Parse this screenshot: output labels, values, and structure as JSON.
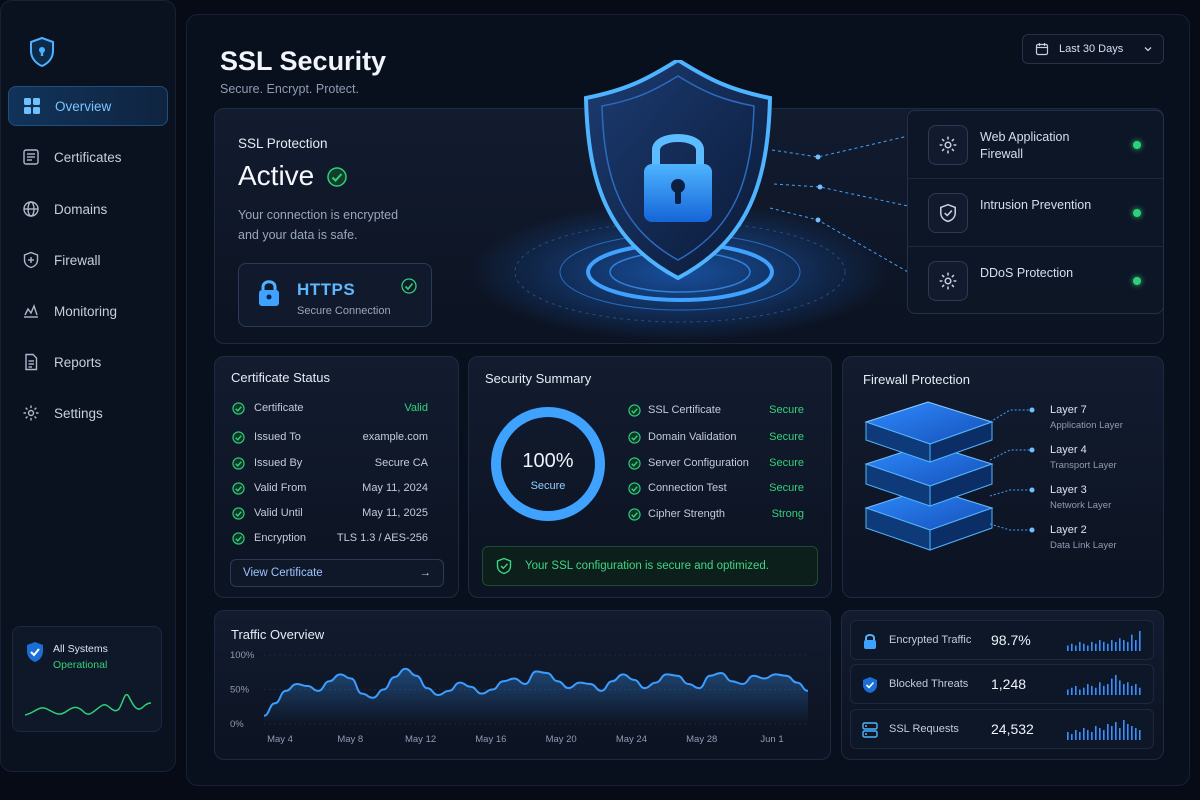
{
  "sidebar": {
    "items": [
      {
        "label": "Overview",
        "icon": "grid-icon",
        "active": true
      },
      {
        "label": "Certificates",
        "icon": "certificate-icon"
      },
      {
        "label": "Domains",
        "icon": "globe-icon"
      },
      {
        "label": "Firewall",
        "icon": "shield-plus-icon"
      },
      {
        "label": "Monitoring",
        "icon": "activity-icon"
      },
      {
        "label": "Reports",
        "icon": "document-icon"
      },
      {
        "label": "Settings",
        "icon": "gear-icon"
      }
    ],
    "status": {
      "title": "All Systems",
      "state": "Operational"
    }
  },
  "header": {
    "title": "SSL Security",
    "subtitle": "Secure. Encrypt. Protect.",
    "date_range": "Last 30 Days"
  },
  "hero": {
    "label": "SSL Protection",
    "status": "Active",
    "description": "Your connection is encrypted and your data is safe.",
    "https": {
      "title": "HTTPS",
      "subtitle": "Secure Connection"
    },
    "protections": [
      {
        "label": "Web Application Firewall",
        "status": "active"
      },
      {
        "label": "Intrusion Prevention",
        "status": "active"
      },
      {
        "label": "DDoS Protection",
        "status": "active"
      }
    ]
  },
  "certificate": {
    "title": "Certificate Status",
    "rows": [
      {
        "key": "Certificate",
        "value": "Valid"
      },
      {
        "key": "Issued To",
        "value": "example.com"
      },
      {
        "key": "Issued By",
        "value": "Secure CA"
      },
      {
        "key": "Valid From",
        "value": "May 11, 2024"
      },
      {
        "key": "Valid Until",
        "value": "May 11, 2025"
      },
      {
        "key": "Encryption",
        "value": "TLS 1.3 / AES-256"
      }
    ],
    "button": "View Certificate"
  },
  "summary": {
    "title": "Security Summary",
    "score": "100%",
    "score_label": "Secure",
    "score_fraction": 1.0,
    "rows": [
      {
        "key": "SSL Certificate",
        "value": "Secure"
      },
      {
        "key": "Domain Validation",
        "value": "Secure"
      },
      {
        "key": "Server Configuration",
        "value": "Secure"
      },
      {
        "key": "Connection Test",
        "value": "Secure"
      },
      {
        "key": "Cipher Strength",
        "value": "Strong"
      }
    ],
    "banner": "Your SSL configuration is secure and optimized."
  },
  "firewall": {
    "title": "Firewall Protection",
    "layers": [
      {
        "name": "Layer 7",
        "desc": "Application Layer"
      },
      {
        "name": "Layer 4",
        "desc": "Transport Layer"
      },
      {
        "name": "Layer 3",
        "desc": "Network Layer"
      },
      {
        "name": "Layer 2",
        "desc": "Data Link Layer"
      }
    ]
  },
  "traffic": {
    "title": "Traffic Overview"
  },
  "chart_data": {
    "type": "area",
    "title": "Traffic Overview",
    "xlabel": "",
    "ylabel": "",
    "y_ticks": [
      "100%",
      "50%",
      "0%"
    ],
    "ylim": [
      0,
      100
    ],
    "x_ticks": [
      "May 4",
      "May 8",
      "May 12",
      "May 16",
      "May 20",
      "May 24",
      "May 28",
      "Jun 1"
    ],
    "x": [
      0,
      1,
      2,
      3,
      4,
      5,
      6,
      7,
      8,
      9,
      10,
      11,
      12,
      13,
      14,
      15,
      16,
      17,
      18,
      19,
      20,
      21,
      22,
      23,
      24,
      25,
      26,
      27,
      28,
      29,
      30,
      31
    ],
    "values": [
      12,
      30,
      48,
      58,
      55,
      48,
      62,
      72,
      66,
      44,
      38,
      50,
      68,
      80,
      70,
      52,
      42,
      48,
      60,
      54,
      44,
      50,
      62,
      66,
      58,
      76,
      74,
      62,
      52,
      60,
      58,
      48,
      62,
      72,
      64,
      52,
      60,
      72,
      70,
      58,
      52,
      70,
      74,
      62,
      58,
      70,
      66,
      72,
      70,
      60,
      48
    ],
    "grid": true,
    "color": "#3b9dff"
  },
  "stats": [
    {
      "label": "Encrypted Traffic",
      "value": "98.7%",
      "icon": "lock-icon",
      "bars": [
        3,
        4,
        3,
        5,
        4,
        3,
        5,
        4,
        6,
        5,
        4,
        6,
        5,
        7,
        6,
        5,
        9,
        6,
        11
      ]
    },
    {
      "label": "Blocked Threats",
      "value": "1,248",
      "icon": "shield-check-icon",
      "bars": [
        3,
        4,
        5,
        3,
        4,
        6,
        5,
        4,
        7,
        5,
        6,
        9,
        11,
        8,
        6,
        7,
        5,
        6,
        4
      ]
    },
    {
      "label": "SSL Requests",
      "value": "24,532",
      "icon": "server-icon",
      "bars": [
        4,
        3,
        5,
        4,
        6,
        5,
        4,
        7,
        6,
        5,
        8,
        7,
        9,
        6,
        10,
        8,
        7,
        6,
        5
      ]
    }
  ],
  "colors": {
    "accent": "#3b9dff",
    "success": "#2ed07a",
    "background": "#060b16"
  }
}
